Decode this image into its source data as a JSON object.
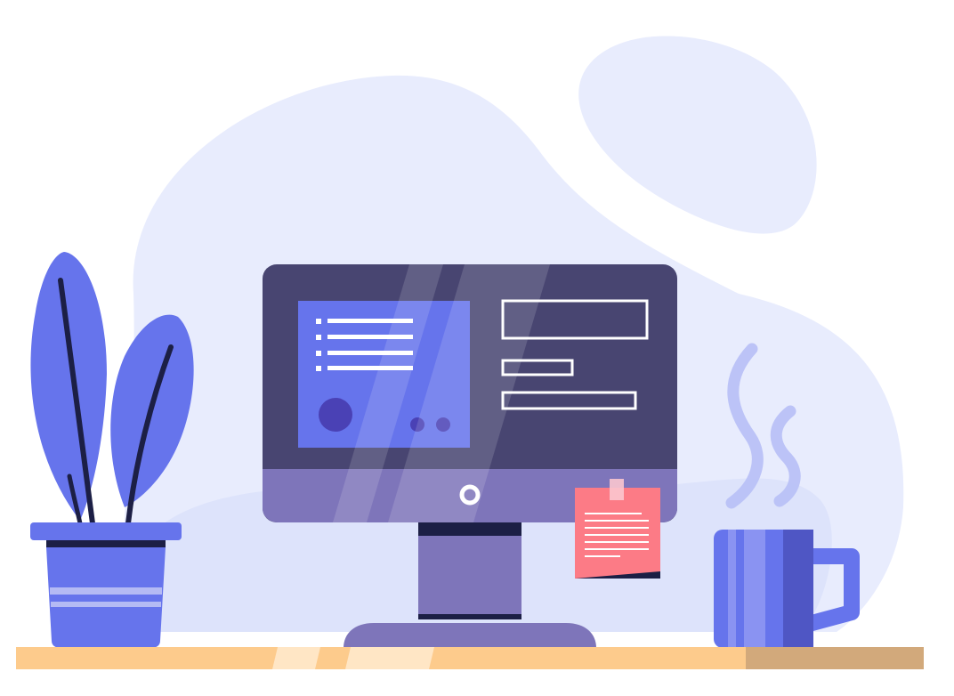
{
  "illustration": {
    "subject": "workspace-desk-illustration",
    "elements": [
      "background-blob",
      "potted-plant",
      "desktop-monitor",
      "sticky-note",
      "coffee-mug",
      "steam",
      "desk-surface"
    ]
  },
  "colors": {
    "background_blob": "#e8ecfd",
    "background_blob_lower": "#dde3fb",
    "accent_blue": "#6674ec",
    "monitor_frame": "#484571",
    "monitor_chin": "#7e75ba",
    "monitor_stand": "#7e75ba",
    "dark_navy": "#1c1f45",
    "sticky_note": "#fc7b86",
    "desk": "#fdcb8c",
    "desk_shadow": "#d2a97b",
    "steam": "#b7bff6"
  }
}
